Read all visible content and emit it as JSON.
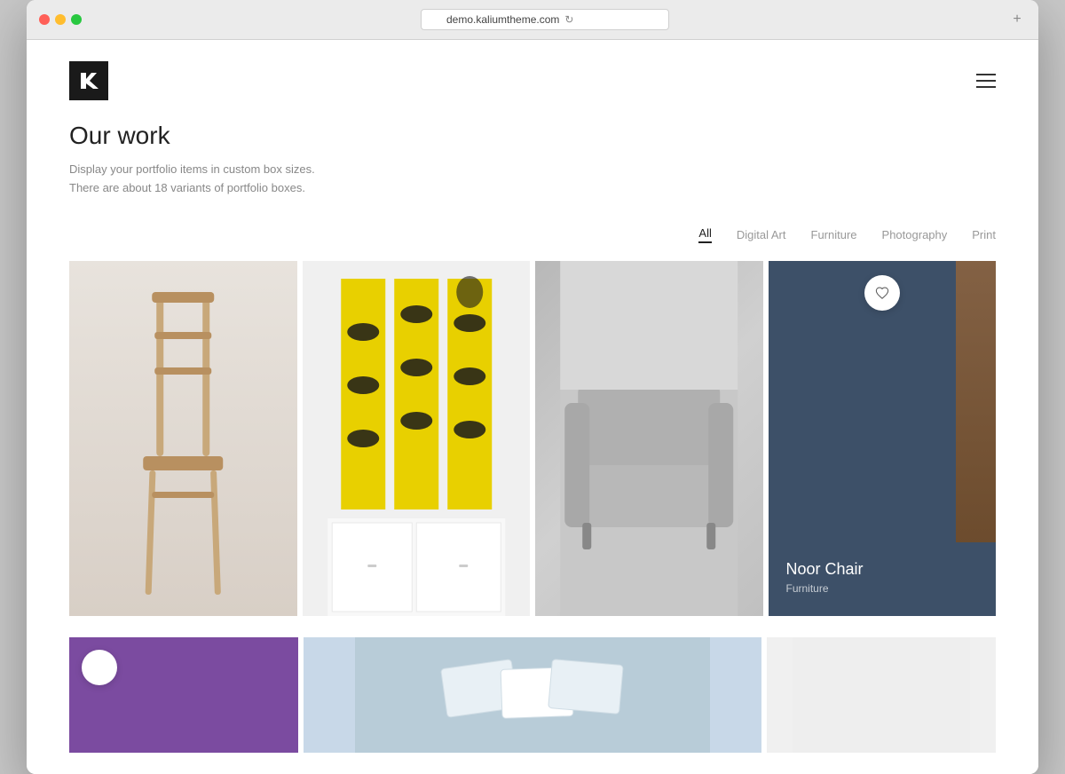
{
  "browser": {
    "url": "demo.kaliumtheme.com",
    "new_tab_icon": "+"
  },
  "header": {
    "logo_text": "K",
    "menu_icon": "≡"
  },
  "hero": {
    "title": "Our work",
    "description_line1": "Display your portfolio items in custom box sizes.",
    "description_line2": "There are about 18 variants of portfolio boxes."
  },
  "filters": [
    {
      "label": "All",
      "active": true
    },
    {
      "label": "Digital Art",
      "active": false
    },
    {
      "label": "Furniture",
      "active": false
    },
    {
      "label": "Photography",
      "active": false
    },
    {
      "label": "Print",
      "active": false
    }
  ],
  "portfolio": {
    "items": [
      {
        "id": "chair",
        "type": "image",
        "alt": "Wooden chair"
      },
      {
        "id": "poster",
        "type": "image",
        "alt": "DNA poster design"
      },
      {
        "id": "sofa",
        "type": "image",
        "alt": "Grey sofa"
      },
      {
        "id": "noor",
        "type": "card",
        "title": "Noor Chair",
        "category": "Furniture"
      }
    ],
    "bottom_items": [
      {
        "id": "purple",
        "type": "color",
        "color": "#7b4ba0"
      },
      {
        "id": "cards",
        "type": "image",
        "alt": "Business cards"
      },
      {
        "id": "white",
        "type": "color",
        "color": "#f0f0f0"
      }
    ]
  },
  "noor_chair": {
    "title": "Noor Chair",
    "category": "Furniture"
  }
}
